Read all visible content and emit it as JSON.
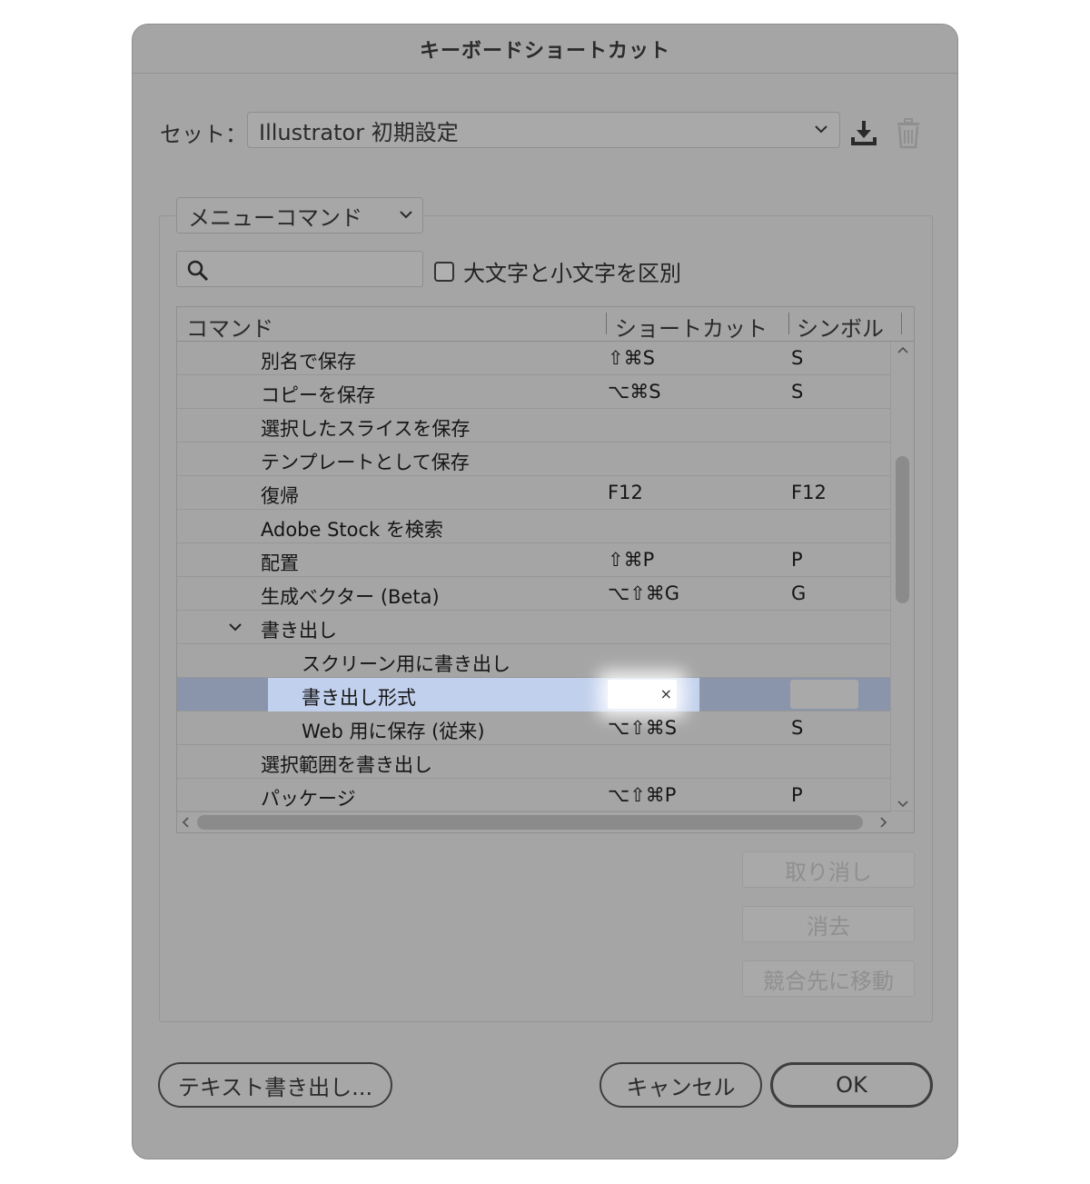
{
  "dialog": {
    "title": "キーボードショートカット"
  },
  "set": {
    "label": "セット：",
    "value": "Illustrator 初期設定"
  },
  "icons": {
    "save": "download-icon",
    "delete": "trash-icon",
    "search": "search-icon"
  },
  "filter": {
    "category": "メニューコマンド",
    "search_value": "",
    "case_label": "大文字と小文字を区別",
    "case_checked": false
  },
  "table": {
    "headers": {
      "command": "コマンド",
      "shortcut": "ショートカット",
      "symbol": "シンボル"
    },
    "rows": [
      {
        "command": "別名で保存",
        "shortcut": "⇧⌘S",
        "symbol": "S",
        "indent": 1
      },
      {
        "command": "コピーを保存",
        "shortcut": "⌥⌘S",
        "symbol": "S",
        "indent": 1
      },
      {
        "command": "選択したスライスを保存",
        "shortcut": "",
        "symbol": "",
        "indent": 1
      },
      {
        "command": "テンプレートとして保存",
        "shortcut": "",
        "symbol": "",
        "indent": 1
      },
      {
        "command": "復帰",
        "shortcut": "F12",
        "symbol": "F12",
        "indent": 1
      },
      {
        "command": "Adobe Stock を検索",
        "shortcut": "",
        "symbol": "",
        "indent": 1
      },
      {
        "command": "配置",
        "shortcut": "⇧⌘P",
        "symbol": "P",
        "indent": 1
      },
      {
        "command": "生成ベクター (Beta)",
        "shortcut": "⌥⇧⌘G",
        "symbol": "G",
        "indent": 1
      },
      {
        "command": "書き出し",
        "shortcut": "",
        "symbol": "",
        "indent": 1,
        "expanded": true
      },
      {
        "command": "スクリーン用に書き出し",
        "shortcut": "",
        "symbol": "",
        "indent": 2
      },
      {
        "command": "書き出し形式",
        "shortcut": "",
        "symbol": "",
        "indent": 2,
        "selected": true,
        "clear": "×"
      },
      {
        "command": "Web 用に保存 (従来)",
        "shortcut": "⌥⇧⌘S",
        "symbol": "S",
        "indent": 2
      },
      {
        "command": "選択範囲を書き出し",
        "shortcut": "",
        "symbol": "",
        "indent": 1
      },
      {
        "command": "パッケージ",
        "shortcut": "⌥⇧⌘P",
        "symbol": "P",
        "indent": 1
      }
    ]
  },
  "side_buttons": {
    "undo": "取り消し",
    "clear": "消去",
    "goto_conflict": "競合先に移動"
  },
  "footer": {
    "export_text": "テキスト書き出し...",
    "cancel": "キャンセル",
    "ok": "OK"
  },
  "colors": {
    "overlay_gray": "#a5a5a5",
    "selection_row": "#8a95ab",
    "selection_highlight": "#c1d0ec"
  }
}
